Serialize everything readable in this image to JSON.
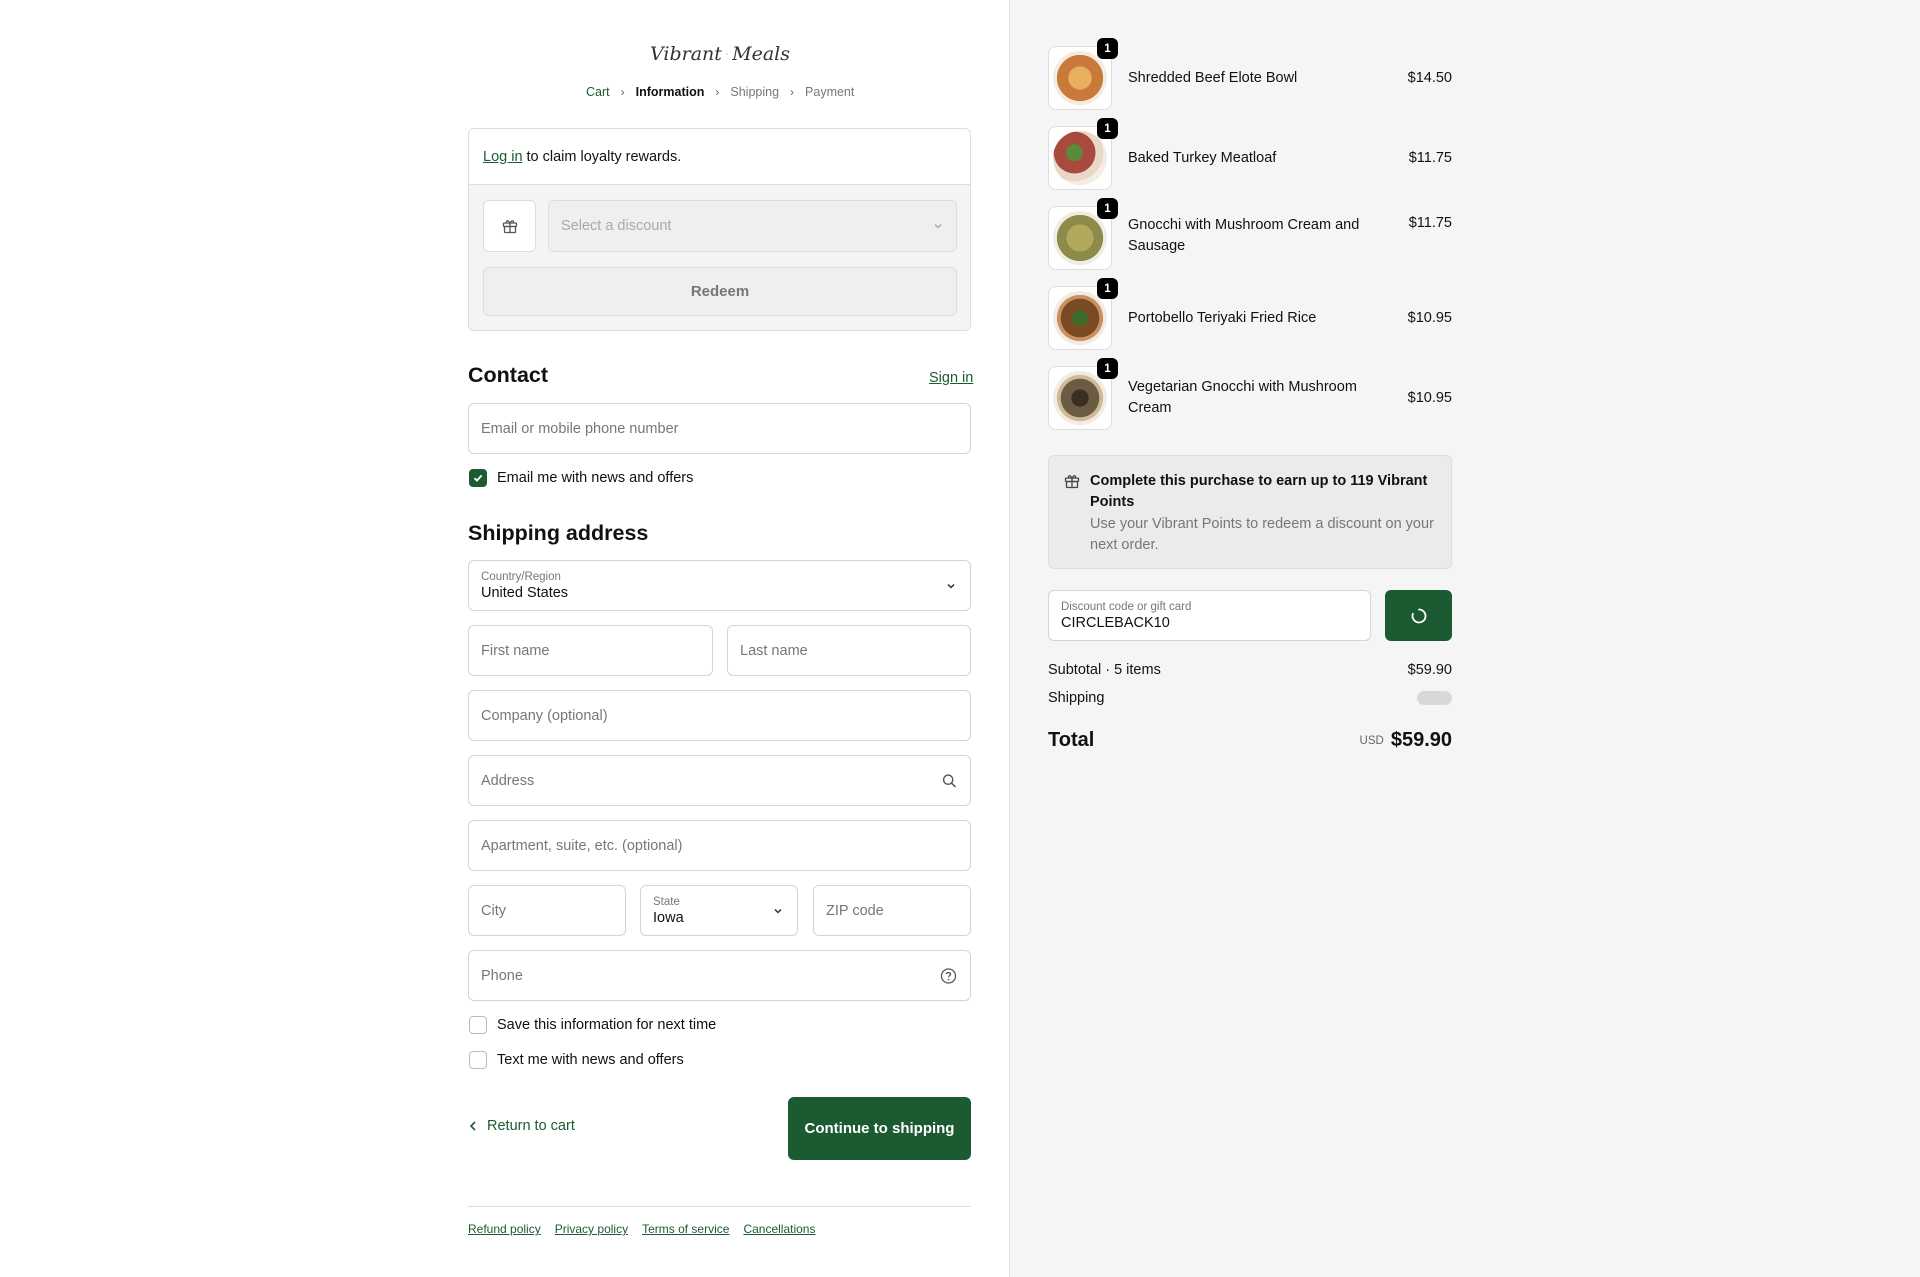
{
  "brand": {
    "logo_text_left": "Vibrant",
    "logo_text_right": "Meals",
    "accent": "#1c5b31"
  },
  "breadcrumb": [
    {
      "label": "Cart",
      "state": "link"
    },
    {
      "label": "Information",
      "state": "active"
    },
    {
      "label": "Shipping",
      "state": "upcoming"
    },
    {
      "label": "Payment",
      "state": "upcoming"
    }
  ],
  "loyalty": {
    "login_link": "Log in",
    "login_text": "to claim loyalty rewards.",
    "discount_placeholder": "Select a discount",
    "redeem_label": "Redeem"
  },
  "contact": {
    "heading": "Contact",
    "signin_label": "Sign in",
    "email_placeholder": "Email or mobile phone number",
    "email_news_label": "Email me with news and offers",
    "email_news_checked": true
  },
  "shipping": {
    "heading": "Shipping address",
    "country_label": "Country/Region",
    "country_value": "United States",
    "first_name_placeholder": "First name",
    "last_name_placeholder": "Last name",
    "company_placeholder": "Company (optional)",
    "address_placeholder": "Address",
    "apartment_placeholder": "Apartment, suite, etc. (optional)",
    "city_placeholder": "City",
    "state_label": "State",
    "state_value": "Iowa",
    "zip_placeholder": "ZIP code",
    "phone_placeholder": "Phone",
    "save_info_label": "Save this information for next time",
    "save_info_checked": false,
    "text_news_label": "Text me with news and offers",
    "text_news_checked": false
  },
  "actions": {
    "return_label": "Return to cart",
    "continue_label": "Continue to shipping"
  },
  "footer": {
    "links": [
      "Refund policy",
      "Privacy policy",
      "Terms of service",
      "Cancellations"
    ]
  },
  "cart": {
    "items": [
      {
        "name": "Shredded Beef Elote Bowl",
        "price": "$14.50",
        "qty": "1",
        "color": "#c9793b"
      },
      {
        "name": "Baked Turkey Meatloaf",
        "price": "$11.75",
        "qty": "1",
        "color": "#a84a3d"
      },
      {
        "name": "Gnocchi with Mushroom Cream and Sausage",
        "price": "$11.75",
        "qty": "1",
        "color": "#8e8a4a"
      },
      {
        "name": "Portobello Teriyaki Fried Rice",
        "price": "$10.95",
        "qty": "1",
        "color": "#7a4a22"
      },
      {
        "name": "Vegetarian Gnocchi with Mushroom Cream",
        "price": "$10.95",
        "qty": "1",
        "color": "#6b5a44"
      }
    ],
    "points_title": "Complete this purchase to earn up to 119 Vibrant Points",
    "points_sub": "Use your Vibrant Points to redeem a discount on your next order.",
    "discount_label": "Discount code or gift card",
    "discount_value": "CIRCLEBACK10",
    "subtotal_label": "Subtotal · 5 items",
    "subtotal_value": "$59.90",
    "shipping_label": "Shipping",
    "total_label": "Total",
    "currency": "USD",
    "total_value": "$59.90"
  }
}
